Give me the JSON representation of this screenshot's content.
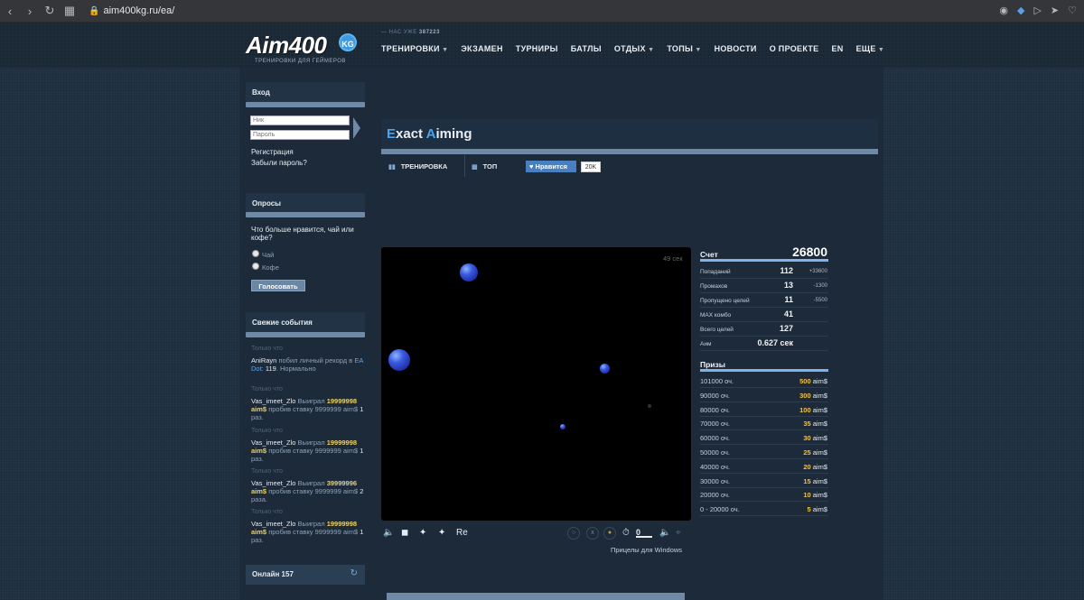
{
  "browser": {
    "url": "aim400kg.ru/ea/"
  },
  "header": {
    "logo_text": "Aim400",
    "logo_badge": "KG",
    "logo_sub": "ТРЕНИРОВКИ ДЛЯ ГЕЙМЕРОВ",
    "users_prefix": "НАС УЖЕ",
    "users_count": "387223",
    "nav": [
      {
        "label": "ТРЕНИРОВКИ",
        "dropdown": true
      },
      {
        "label": "ЭКЗАМЕН",
        "dropdown": false
      },
      {
        "label": "ТУРНИРЫ",
        "dropdown": false
      },
      {
        "label": "БАТЛЫ",
        "dropdown": false
      },
      {
        "label": "ОТДЫХ",
        "dropdown": true
      },
      {
        "label": "ТОПЫ",
        "dropdown": true
      },
      {
        "label": "НОВОСТИ",
        "dropdown": false
      },
      {
        "label": "О ПРОЕКТЕ",
        "dropdown": false
      },
      {
        "label": "EN",
        "dropdown": false
      },
      {
        "label": "ЕЩЕ",
        "dropdown": true
      }
    ]
  },
  "login": {
    "title": "Вход",
    "nick_placeholder": "Ник",
    "pass_placeholder": "Пароль",
    "register": "Регистрация",
    "forgot": "Забыли пароль?"
  },
  "poll": {
    "title": "Опросы",
    "question": "Что больше нравится, чай или кофе?",
    "options": [
      "Чай",
      "Кофе"
    ],
    "vote": "Голосовать"
  },
  "events": {
    "title": "Свежие события",
    "items": [
      {
        "time": "Только что",
        "user": "AniRayn",
        "text1": " побил личный рекорд в ",
        "link": "EA Dot",
        "text2": ": ",
        "value": "119",
        "text3": ". Нормально"
      },
      {
        "time": "Только что",
        "user": "Vas_imeet_Zlo",
        "text1": " Выиграл ",
        "amount": "19999998 aim$",
        "text2": " пробив ставку 9999999 aim$ ",
        "count": "1",
        "text3": " раз."
      },
      {
        "time": "Только что",
        "user": "Vas_imeet_Zlo",
        "text1": " Выиграл ",
        "amount": "19999998 aim$",
        "text2": " пробив ставку 9999999 aim$ ",
        "count": "1",
        "text3": " раз."
      },
      {
        "time": "Только что",
        "user": "Vas_imeet_Zlo",
        "text1": " Выиграл ",
        "amount": "39999996 aim$",
        "text2": " пробив ставку 9999999 aim$ ",
        "count": "2",
        "text3": " раза."
      },
      {
        "time": "Только что",
        "user": "Vas_imeet_Zlo",
        "text1": " Выиграл ",
        "amount": "19999998 aim$",
        "text2": " пробив ставку 9999999 aim$ ",
        "count": "1",
        "text3": " раз."
      }
    ]
  },
  "online": {
    "label": "Онлайн 157"
  },
  "page": {
    "title_a": "E",
    "title_b": "xact ",
    "title_c": "A",
    "title_d": "iming",
    "tab_training": "ТРЕНИРОВКА",
    "tab_top": "ТОП",
    "like_label": "Нравится",
    "like_count": "20K"
  },
  "game": {
    "timer": "49 сек",
    "controls_text": "Re",
    "cursors_link": "Прицелы для Windows",
    "volume_value": "0"
  },
  "score": {
    "title": "Счет",
    "total": "26800",
    "rows": [
      {
        "label": "Попаданий",
        "value": "112",
        "delta": "+33600"
      },
      {
        "label": "Промахов",
        "value": "13",
        "delta": "-1300"
      },
      {
        "label": "Пропущено целей",
        "value": "11",
        "delta": "-5500"
      },
      {
        "label": "MAX комбо",
        "value": "41",
        "delta": ""
      },
      {
        "label": "Всего целей",
        "value": "127",
        "delta": ""
      },
      {
        "label": "Аим",
        "value": "0.627 сек",
        "delta": ""
      }
    ]
  },
  "prizes": {
    "title": "Призы",
    "rows": [
      {
        "label": "101000 оч.",
        "amount": "500",
        "unit": " aim$"
      },
      {
        "label": "90000 оч.",
        "amount": "300",
        "unit": " aim$"
      },
      {
        "label": "80000 оч.",
        "amount": "100",
        "unit": " aim$"
      },
      {
        "label": "70000 оч.",
        "amount": "35",
        "unit": " aim$"
      },
      {
        "label": "60000 оч.",
        "amount": "30",
        "unit": " aim$"
      },
      {
        "label": "50000 оч.",
        "amount": "25",
        "unit": " aim$"
      },
      {
        "label": "40000 оч.",
        "amount": "20",
        "unit": " aim$"
      },
      {
        "label": "30000 оч.",
        "amount": "15",
        "unit": " aim$"
      },
      {
        "label": "20000 оч.",
        "amount": "10",
        "unit": " aim$"
      },
      {
        "label": "0 - 20000 оч.",
        "amount": "5",
        "unit": " aim$"
      }
    ]
  }
}
